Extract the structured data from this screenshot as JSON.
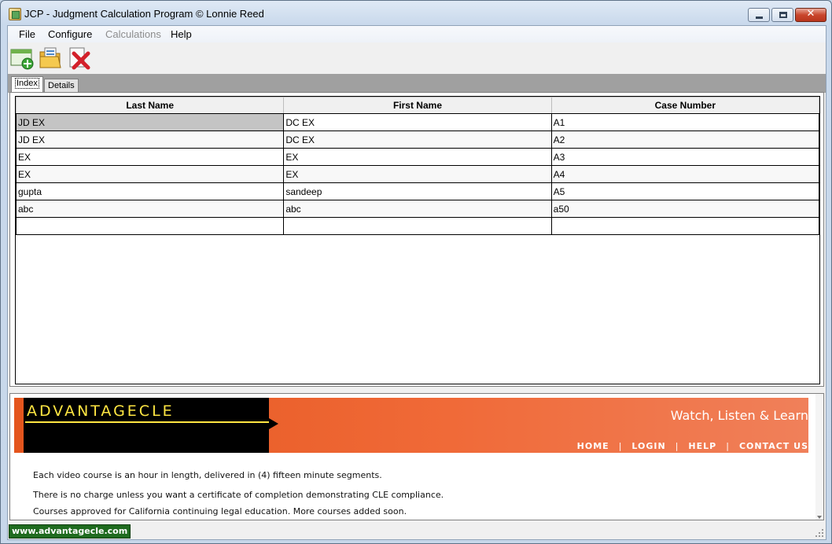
{
  "window": {
    "title": "JCP - Judgment Calculation Program © Lonnie Reed",
    "close_glyph": "✕"
  },
  "menu": {
    "file": "File",
    "configure": "Configure",
    "calculations": "Calculations",
    "help": "Help"
  },
  "tabs": {
    "index": "Index",
    "details": "Details"
  },
  "grid": {
    "columns": [
      "Last Name",
      "First Name",
      "Case Number"
    ],
    "rows": [
      [
        "JD EX",
        "DC EX",
        "A1"
      ],
      [
        "JD EX",
        "DC EX",
        "A2"
      ],
      [
        "EX",
        "EX",
        "A3"
      ],
      [
        "EX",
        "EX",
        "A4"
      ],
      [
        "gupta",
        "sandeep",
        "A5"
      ],
      [
        "abc",
        "abc",
        "a50"
      ],
      [
        "",
        "",
        ""
      ]
    ]
  },
  "ad": {
    "logo": "ADVANTAGECLE",
    "tagline": "Watch, Listen & Learn",
    "nav": [
      "HOME",
      "LOGIN",
      "HELP",
      "CONTACT US"
    ],
    "nav_sep": "|",
    "lines": [
      "Each video course is an hour in length, delivered in (4) fifteen minute segments.",
      "There is no charge unless you want a certificate of completion demonstrating CLE compliance.",
      "Courses approved for California continuing legal education. More courses added soon."
    ],
    "colors": {
      "banner": "#e4551d",
      "logo_text": "#ffe642"
    }
  },
  "status": {
    "link": "www.advantagecle.com"
  }
}
